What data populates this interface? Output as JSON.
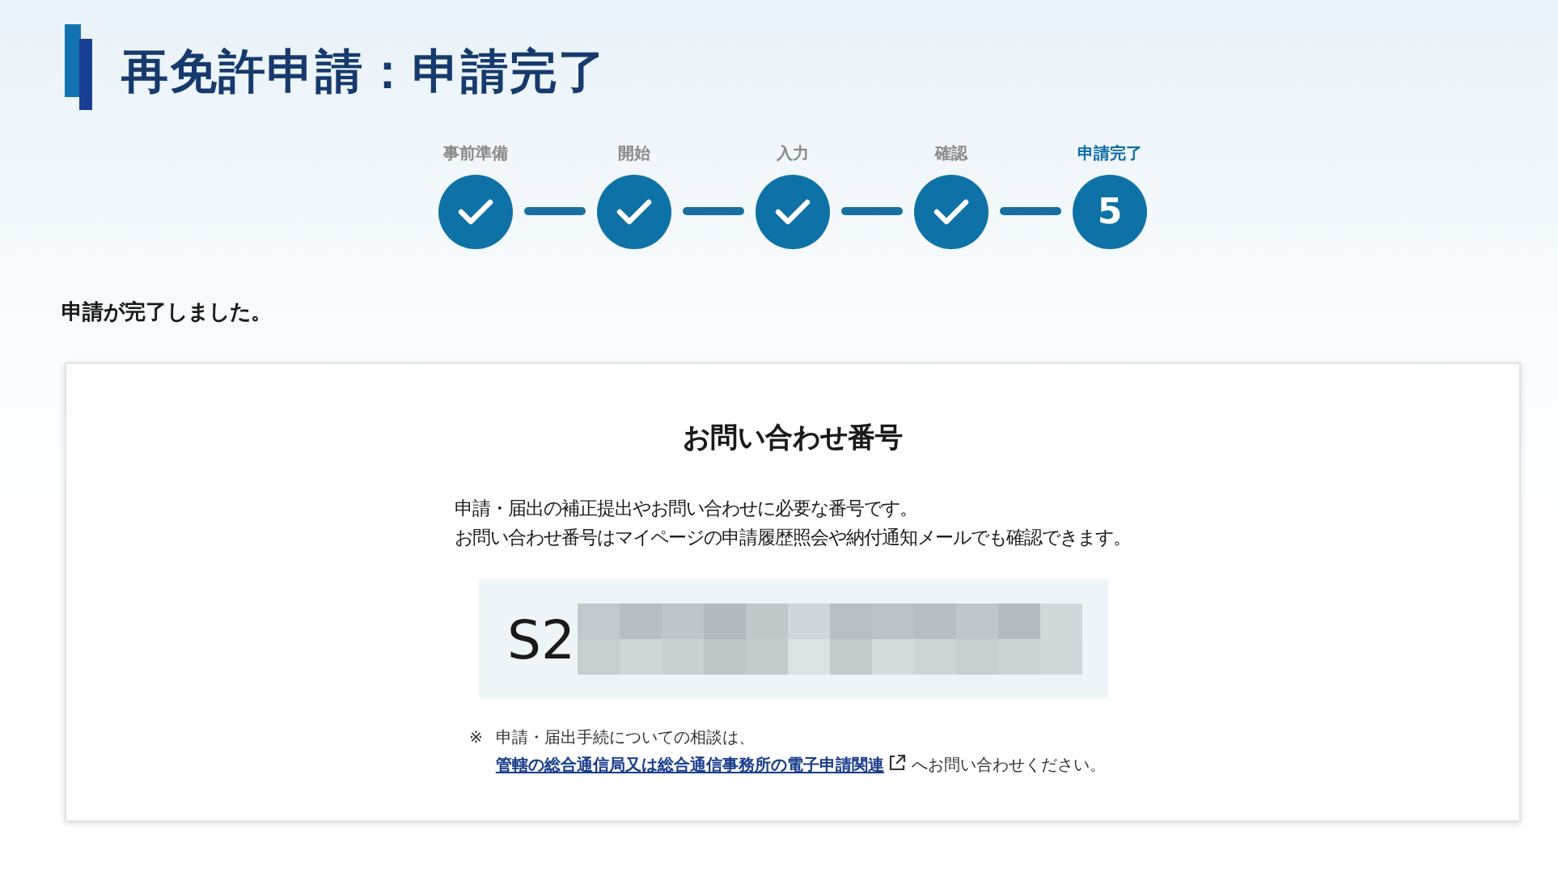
{
  "page": {
    "title": "再免許申請：申請完了"
  },
  "steps": [
    {
      "label": "事前準備",
      "kind": "done",
      "selected": false
    },
    {
      "label": "開始",
      "kind": "done",
      "selected": false
    },
    {
      "label": "入力",
      "kind": "done",
      "selected": false
    },
    {
      "label": "確認",
      "kind": "done",
      "selected": false
    },
    {
      "label": "申請完了",
      "kind": "current",
      "number": "5",
      "selected": true
    }
  ],
  "message": "申請が完了しました。",
  "card": {
    "heading": "お問い合わせ番号",
    "description": [
      "申請・届出の補正提出やお問い合わせに必要な番号です。",
      "お問い合わせ番号はマイページの申請履歴照会や納付通知メールでも確認できます。"
    ],
    "inquiry_number": "S2",
    "note": {
      "mark": "※",
      "text_before": "申請・届出手続についての相談は、",
      "link": "管轄の総合通信局又は総合通信事務所の電子申請関連",
      "text_after": "へお問い合わせください。"
    }
  }
}
